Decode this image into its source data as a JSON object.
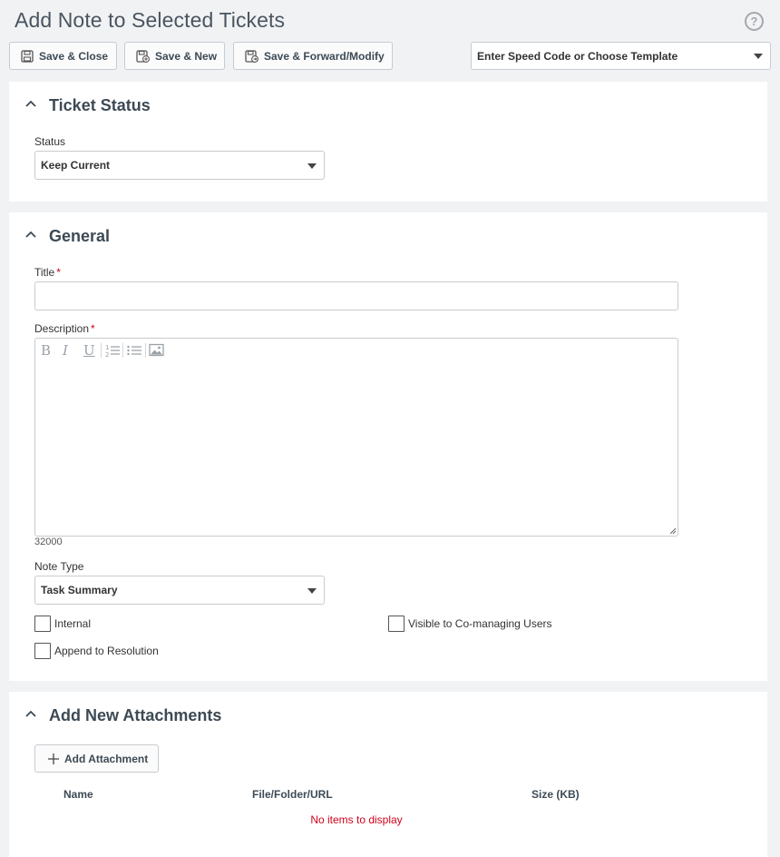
{
  "page": {
    "title": "Add Note to Selected Tickets"
  },
  "toolbar": {
    "save_close": "Save & Close",
    "save_new": "Save & New",
    "save_forward": "Save & Forward/Modify",
    "speed_code": "Enter Speed Code or Choose Template"
  },
  "ticket_status": {
    "title": "Ticket Status",
    "status_label": "Status",
    "status_value": "Keep Current"
  },
  "general": {
    "title": "General",
    "title_label": "Title",
    "title_value": "",
    "required_mark": "*",
    "description_label": "Description",
    "description_value": "",
    "char_counter": "32000",
    "note_type_label": "Note Type",
    "note_type_value": "Task Summary",
    "checkboxes": {
      "internal": {
        "label": "Internal",
        "checked": false
      },
      "visible_comanaging": {
        "label": "Visible to Co-managing Users",
        "checked": false
      },
      "append_resolution": {
        "label": "Append to Resolution",
        "checked": false
      }
    }
  },
  "attachments": {
    "title": "Add New Attachments",
    "add_button": "Add Attachment",
    "columns": [
      "Name",
      "File/Folder/URL",
      "Size (KB)"
    ],
    "empty_text": "No items to display"
  },
  "colors": {
    "accent": "#3d4a55",
    "required": "#d0021b",
    "border": "#c7cbcf",
    "background": "#f1f2f4"
  }
}
